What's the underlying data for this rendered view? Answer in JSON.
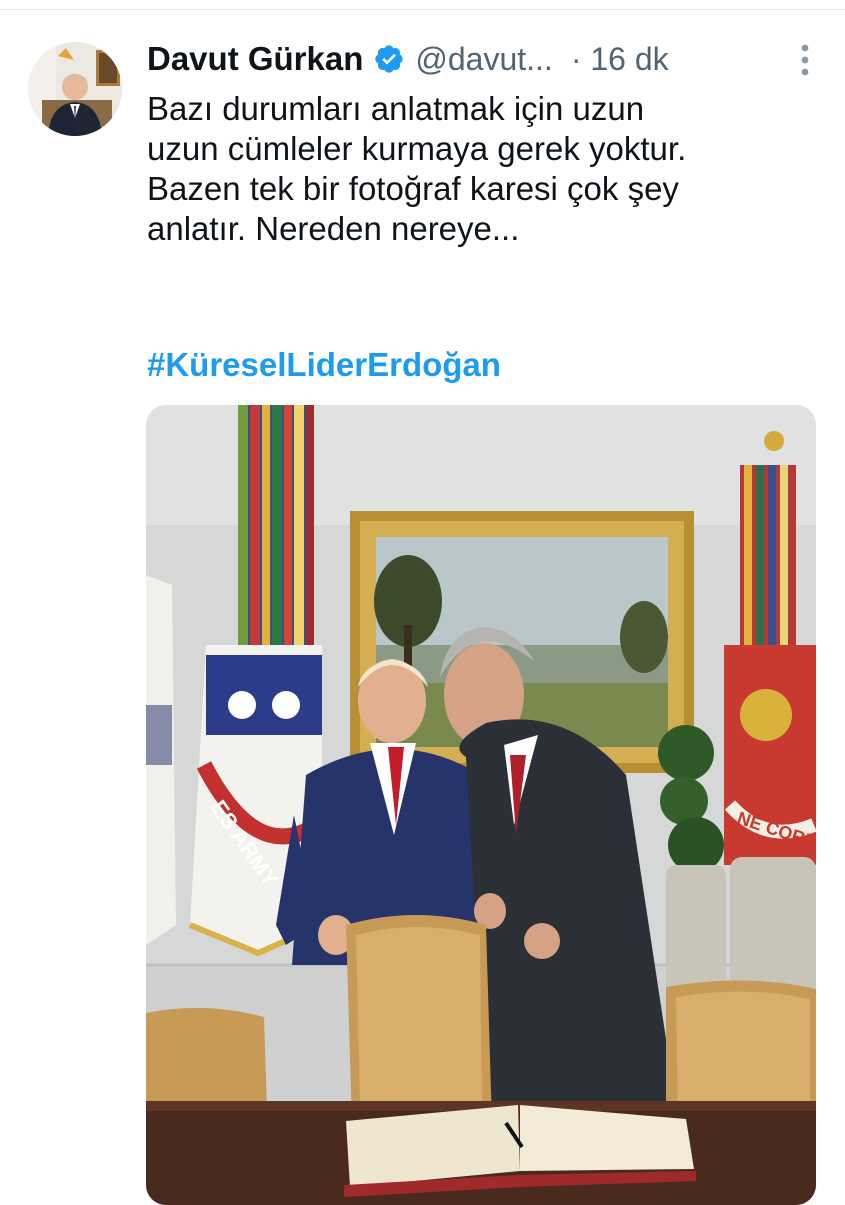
{
  "tweet": {
    "author": {
      "display_name": "Davut Gürkan",
      "handle": "@davut...",
      "verified": true,
      "avatar_icon": "profile-photo"
    },
    "time": "· 16 dk",
    "text": "Bazı durumları anlatmak için uzun\nuzun cümleler kurmaya gerek yoktur.\nBazen tek bir fotoğraf karesi çok şey\nanlatır. Nereden nereye...",
    "hashtag": "#KüreselLiderErdoğan",
    "media": {
      "alt": "Photo of two men in suits standing by leather chairs and an open guest book in a room with flags and a landscape painting",
      "flag_texts": [
        "ES ARMY",
        "NE CORPS"
      ]
    },
    "more_icon": "more-vertical-icon"
  },
  "colors": {
    "link": "#1d9bf0",
    "secondary_text": "#536471",
    "verified_badge": "#1d9bf0"
  }
}
